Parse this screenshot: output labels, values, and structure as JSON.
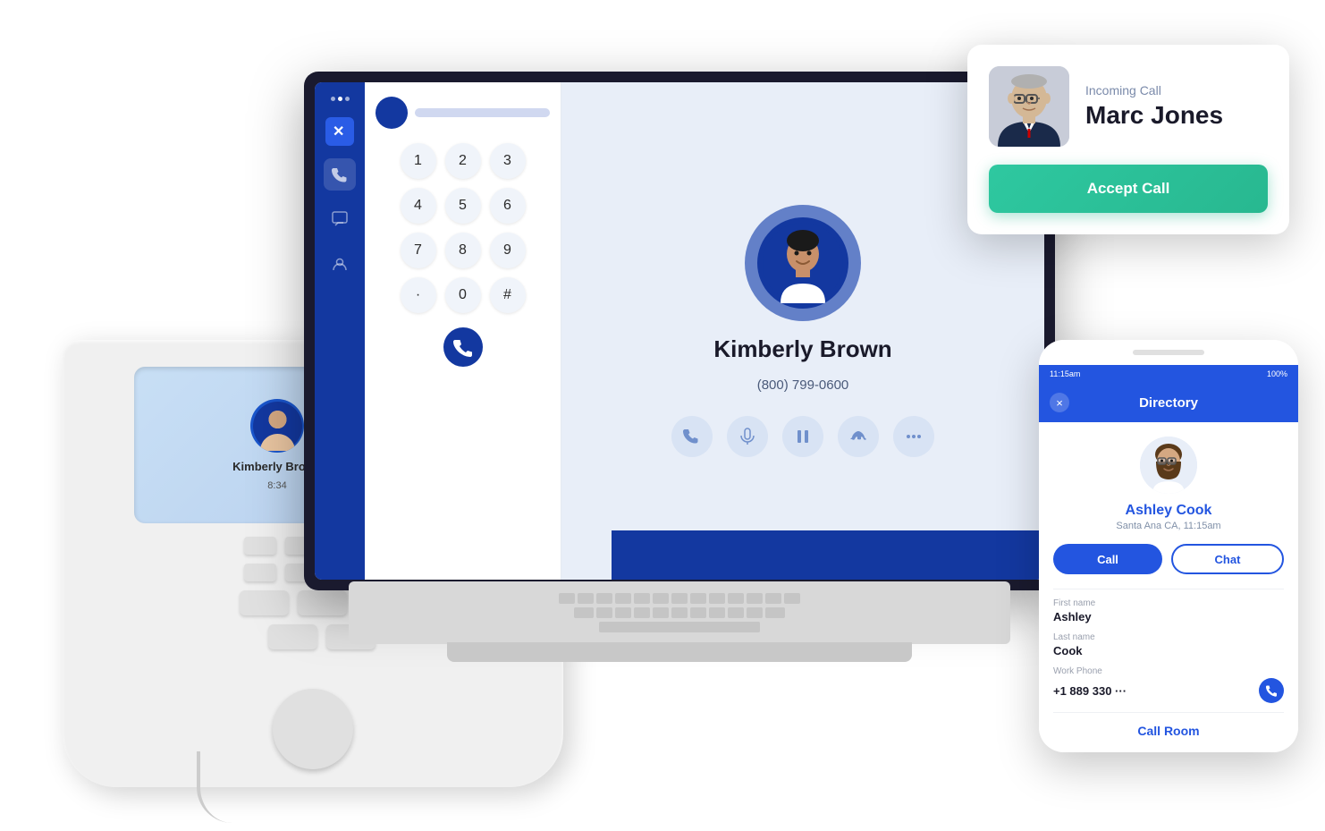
{
  "scene": {
    "background": "#ffffff"
  },
  "desk_phone": {
    "screen": {
      "contact_name": "Kimberly Brown",
      "duration": "8:34"
    }
  },
  "laptop_app": {
    "dialer": {
      "keys": [
        "1",
        "2",
        "3",
        "4",
        "5",
        "6",
        "7",
        "8",
        "9",
        "·",
        "0",
        "#"
      ]
    },
    "contact": {
      "name": "Kimberly Brown",
      "phone": "(800) 799-0600"
    }
  },
  "incoming_call_popup": {
    "label": "Incoming Call",
    "caller_name": "Marc Jones",
    "accept_button_label": "Accept Call"
  },
  "mobile_panel": {
    "header_title": "Directory",
    "close_label": "×",
    "contact": {
      "name": "Ashley Cook",
      "location": "Santa Ana CA, 11:15am",
      "first_name_label": "First name",
      "first_name": "Ashley",
      "last_name_label": "Last name",
      "last_name": "Cook",
      "work_phone_label": "Work Phone",
      "work_phone": "+1 889 330 ···"
    },
    "call_button_label": "Call",
    "chat_button_label": "Chat",
    "call_room_label": "Call Room",
    "status_time": "11:15am",
    "battery": "100%"
  }
}
